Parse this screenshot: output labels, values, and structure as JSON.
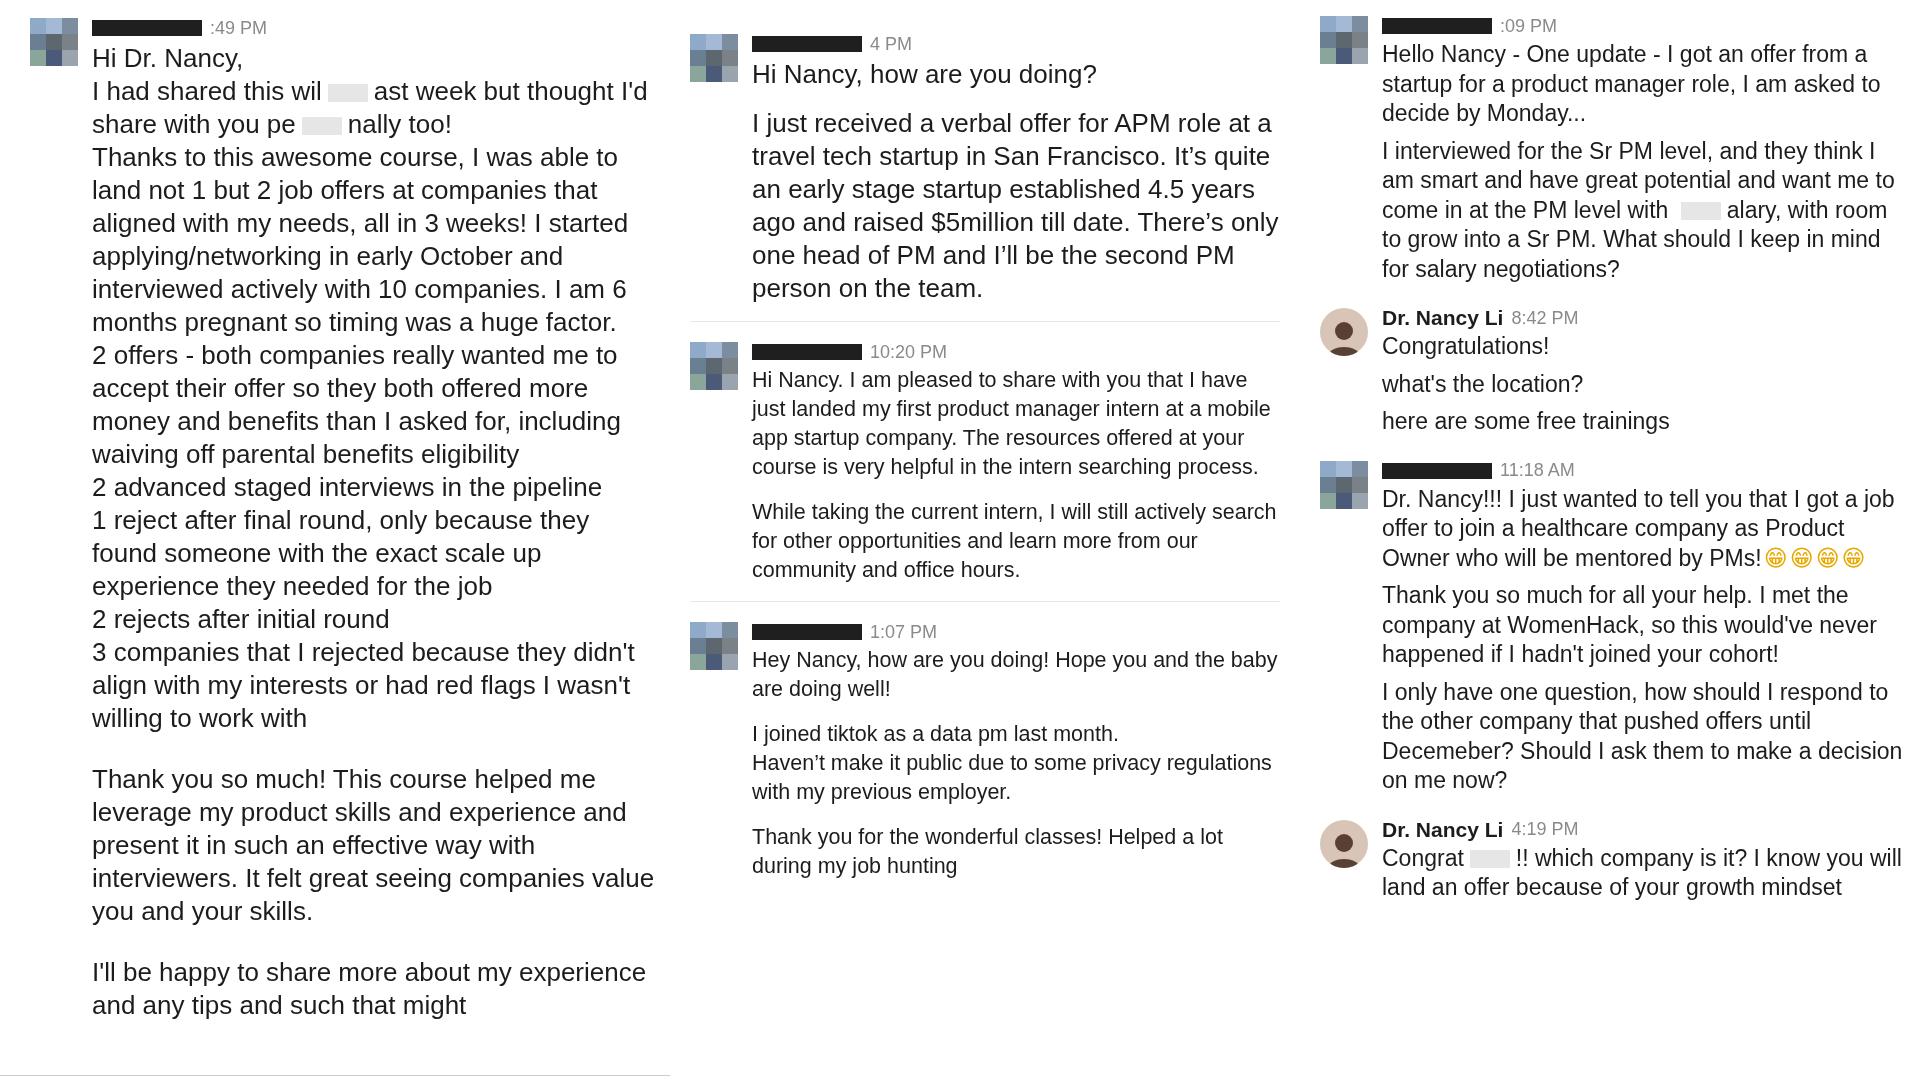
{
  "columns": [
    {
      "messages": [
        {
          "avatar": {
            "kind": "pixelated"
          },
          "time": ":49 PM",
          "blocks": [
            [
              "Hi Dr. Nancy,",
              [
                "I had shared this wil",
                "ast week but thought I'd share with you pe",
                "nally too!"
              ],
              "Thanks to this awesome course, I was able to land not 1 but 2 job offers at companies that aligned with my needs, all in 3 weeks! I started  applying/networking in early October and interviewed actively with 10 companies. I am 6 months pregnant so timing was a huge factor.",
              "2 offers - both companies really wanted me to accept their offer so they both offered more money and benefits than I asked for, including waiving off parental benefits eligibility",
              "2 advanced staged interviews in the pipeline",
              "1 reject after final round, only because they found someone with the exact scale up experience they needed for the job",
              "2 rejects after initial round",
              "3 companies that I rejected because they didn't align with my interests or had red flags I wasn't willing to work with"
            ],
            [
              "Thank you so much! This course helped me leverage my product skills and experience and present it in such an effective way with interviewers. It felt great seeing companies value you and your skills."
            ],
            [
              "I'll be happy to share more about my experience and any tips and such that might"
            ]
          ]
        }
      ]
    },
    {
      "messages": [
        {
          "avatar": {
            "kind": "pixelated"
          },
          "time": "4 PM",
          "blocks": [
            [
              "Hi Nancy, how are you doing?"
            ],
            [
              "I just received a verbal offer for APM role at a travel tech startup in San Francisco. It’s quite an early stage startup established 4.5 years ago and raised $5million till date. There’s only one head of PM and I’ll be the second PM person on the team."
            ]
          ]
        },
        {
          "avatar": {
            "kind": "pixelated"
          },
          "time": "10:20 PM",
          "blocks": [
            [
              "Hi Nancy. I am pleased to share with you that I have just landed my first product manager intern at a mobile app startup company. The resources offered at your course is very helpful in the intern searching process."
            ],
            [
              "While taking the current intern, I will still actively search for other opportunities and learn more from our community and office hours."
            ]
          ]
        },
        {
          "avatar": {
            "kind": "pixelated"
          },
          "time": "1:07 PM",
          "blocks": [
            [
              "Hey Nancy, how are you doing! Hope you and the baby are doing well!"
            ],
            [
              "I joined tiktok as a data pm last month.",
              "Haven’t make it public due to some privacy regulations with my previous employer."
            ],
            [
              "Thank you for the wonderful classes! Helped a lot during my job hunting"
            ]
          ]
        }
      ]
    },
    {
      "messages": [
        {
          "avatar": {
            "kind": "pixelated"
          },
          "time": ":09 PM",
          "blocks": [
            [
              "Hello Nancy - One update - I got an offer from a startup for a product manager role, I am asked to decide by Monday..."
            ],
            [
              [
                "I interviewed for the Sr PM level, and they think I am smart and have great potential and want me to come in at the PM level with ",
                "alary, with room to grow into a Sr PM. What should I keep in mind for salary negotiations?"
              ]
            ]
          ]
        },
        {
          "avatar": {
            "kind": "photo"
          },
          "name": "Dr. Nancy Li",
          "time": "8:42 PM",
          "blocks": [
            [
              "Congratulations!"
            ],
            [
              "what's the location?"
            ],
            [
              "here are some free trainings"
            ]
          ]
        },
        {
          "avatar": {
            "kind": "pixelated"
          },
          "time": "11:18 AM",
          "emojis": [
            "😁",
            "😁",
            "😁",
            "😁"
          ],
          "blocks": [
            [
              "Dr. Nancy!!! I just wanted to tell you that I got a job offer to join a healthcare company as Product Owner who will be mentored by PMs!"
            ],
            [
              "Thank you so much for all your help. I met the company at WomenHack, so this would've never happened if I hadn't joined your cohort!"
            ],
            [
              "I only have one question, how should I respond to the other company that pushed offers until Decemeber? Should I ask them to make a decision on me now?"
            ]
          ]
        },
        {
          "avatar": {
            "kind": "photo"
          },
          "name": "Dr. Nancy Li",
          "time": "4:19 PM",
          "blocks": [
            [
              [
                "Congrat",
                "!! which company is it? I know you will land an offer because of your growth mindset"
              ]
            ]
          ]
        }
      ]
    }
  ]
}
